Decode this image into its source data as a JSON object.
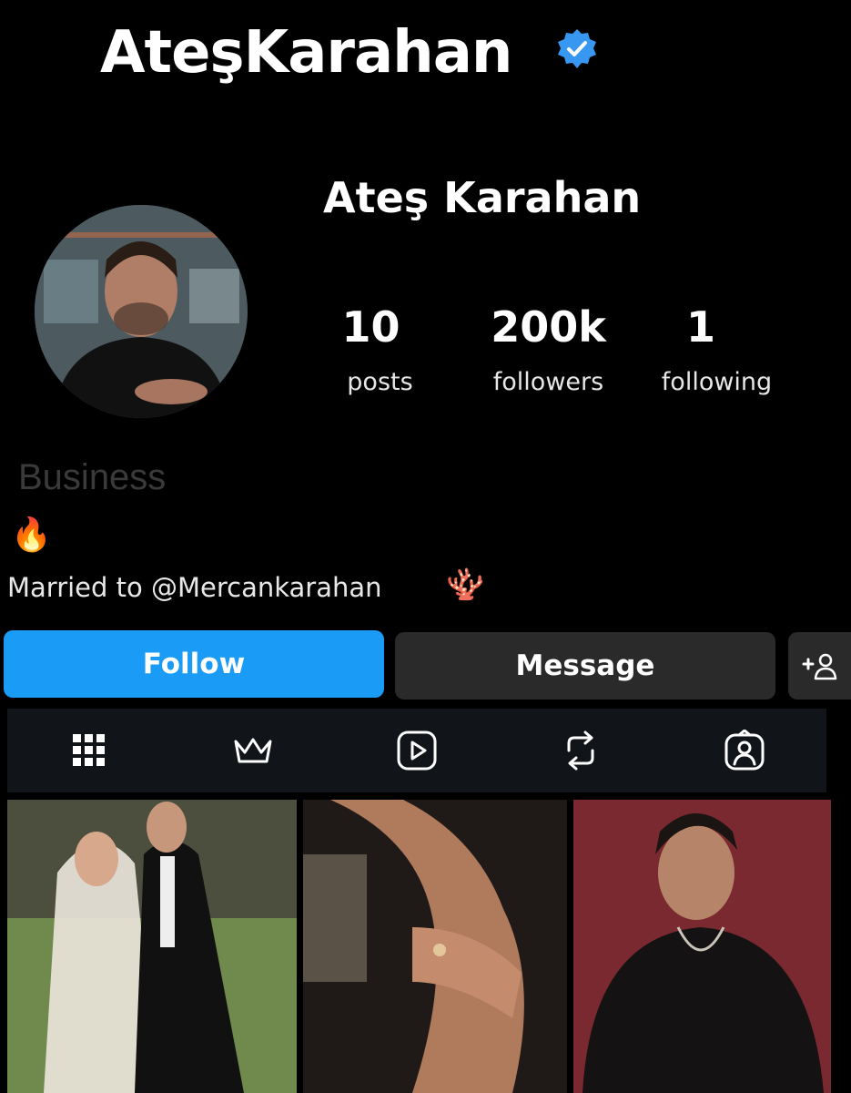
{
  "profile": {
    "username": "AteşKarahan",
    "display_name": "Ateş Karahan",
    "verified_icon": "verified-badge-icon",
    "category": "Business",
    "fire_emoji": "🔥",
    "bio": "Married to @Mercankarahan",
    "coral_emoji": "🪸"
  },
  "stats": {
    "posts_count": "10",
    "posts_label": "posts",
    "followers_count": "200k",
    "followers_label": "followers",
    "following_count": "1",
    "following_label": "following"
  },
  "actions": {
    "follow_label": "Follow",
    "message_label": "Message",
    "add_user_icon": "add-user-icon"
  },
  "tabs": [
    "grid-icon",
    "crown-icon",
    "reels-icon",
    "reposts-icon",
    "tagged-icon"
  ],
  "colors": {
    "follow_blue": "#1a9bf6",
    "verified_blue": "#3897f0",
    "background": "#000000"
  }
}
